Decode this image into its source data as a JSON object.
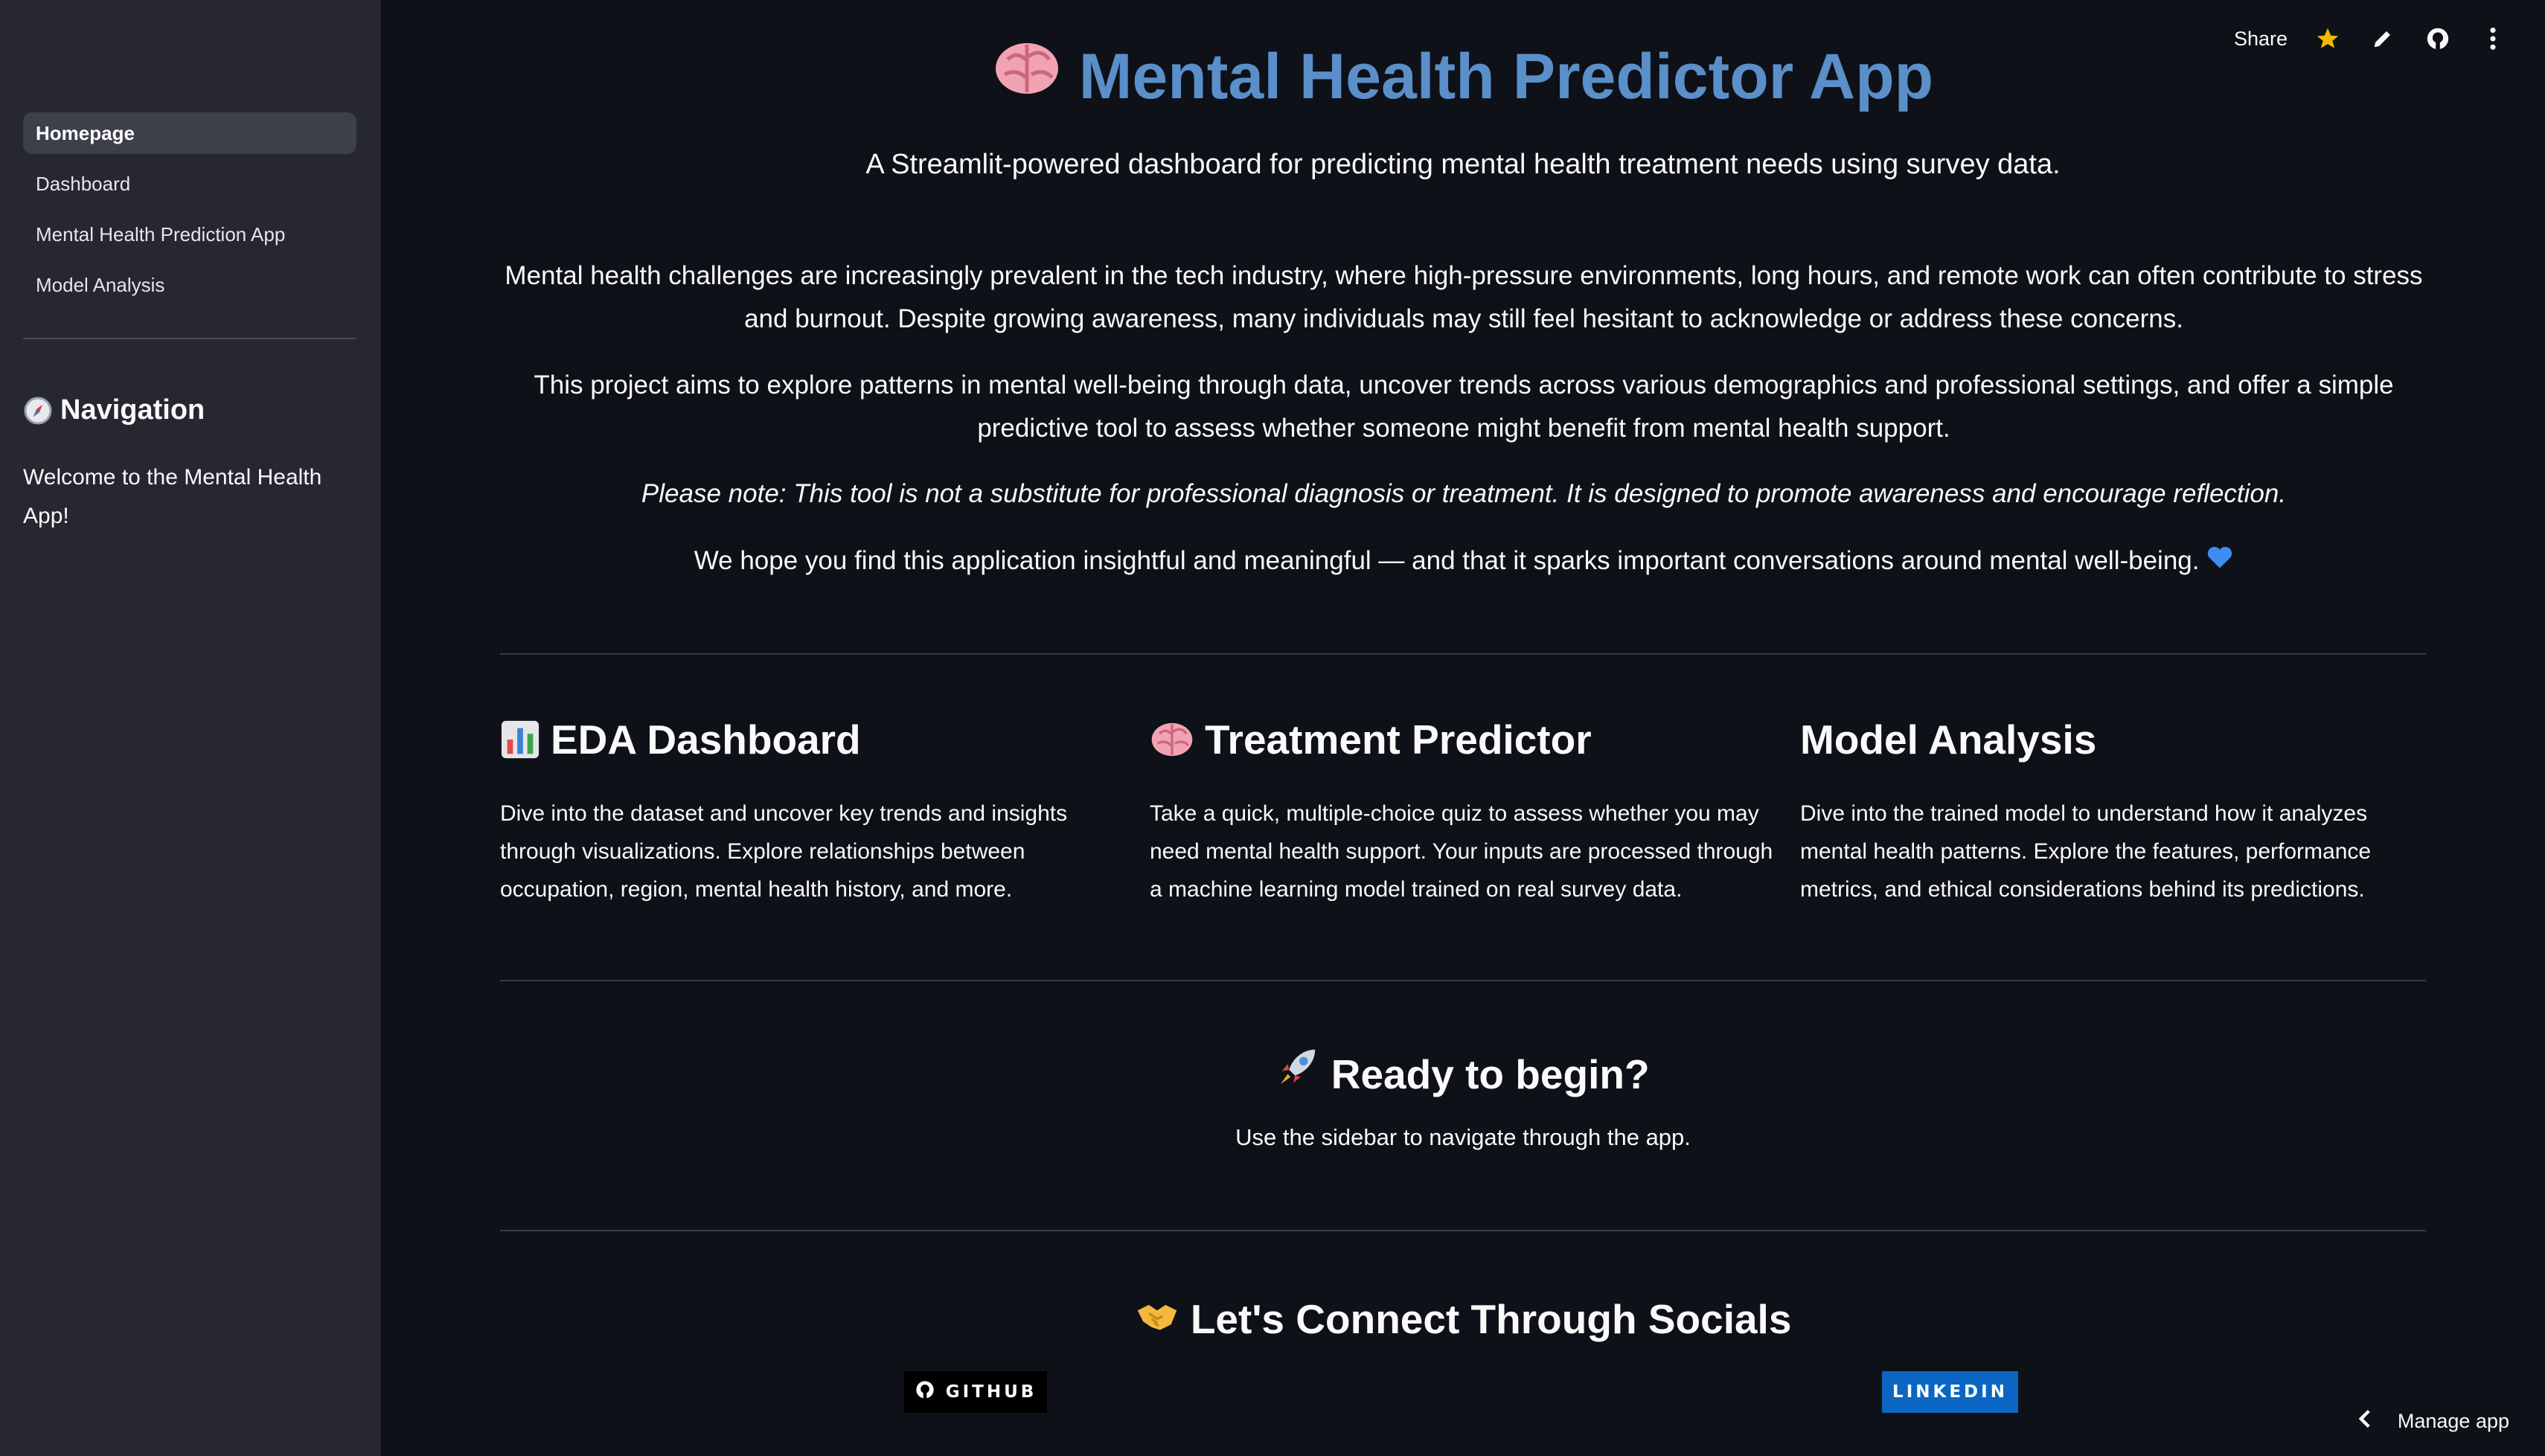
{
  "sidebar": {
    "nav_items": [
      {
        "label": "Homepage",
        "active": true
      },
      {
        "label": "Dashboard"
      },
      {
        "label": "Mental Health Prediction App"
      },
      {
        "label": "Model Analysis"
      }
    ],
    "heading": "Navigation",
    "heading_icon": "compass-icon",
    "welcome": "Welcome to the Mental Health App!"
  },
  "toolbar": {
    "share": "Share",
    "icons": [
      "star-icon",
      "pencil-icon",
      "github-icon",
      "more-icon"
    ]
  },
  "main": {
    "title": "Mental Health Predictor App",
    "title_icon": "brain-icon",
    "title_color": "#5a8fc9",
    "subtitle": "A Streamlit-powered dashboard for predicting mental health treatment needs using survey data.",
    "paragraphs": [
      "Mental health challenges are increasingly prevalent in the tech industry, where high-pressure environments, long hours, and remote work can often contribute to stress and burnout. Despite growing awareness, many individuals may still feel hesitant to acknowledge or address these concerns.",
      "This project aims to explore patterns in mental well-being through data, uncover trends across various demographics and professional settings, and offer a simple predictive tool to assess whether someone might benefit from mental health support.",
      "Please note: This tool is not a substitute for professional diagnosis or treatment. It is designed to promote awareness and encourage reflection.",
      "We hope you find this application insightful and meaningful — and that it sparks important conversations around mental well-being."
    ],
    "columns": [
      {
        "title": "EDA Dashboard",
        "icon": "bar-chart-icon",
        "body": "Dive into the dataset and uncover key trends and insights through visualizations. Explore relationships between occupation, region, mental health history, and more."
      },
      {
        "title": "Treatment Predictor",
        "icon": "brain-icon",
        "body": "Take a quick, multiple-choice quiz to assess whether you may need mental health support. Your inputs are processed through a machine learning model trained on real survey data."
      },
      {
        "title": "Model Analysis",
        "body": "Dive into the trained model to understand how it analyzes mental health patterns. Explore the features, performance metrics, and ethical considerations behind its predictions."
      }
    ],
    "ready_title": "Ready to begin?",
    "ready_icon": "rocket-icon",
    "ready_text": "Use the sidebar to navigate through the app.",
    "socials_title": "Let's Connect Through Socials",
    "socials_icon": "handshake-icon",
    "github_label": "GITHUB",
    "linkedin_label": "LINKEDIN",
    "linkedin_color": "#0a66c2"
  },
  "footer": {
    "manage": "Manage app"
  }
}
